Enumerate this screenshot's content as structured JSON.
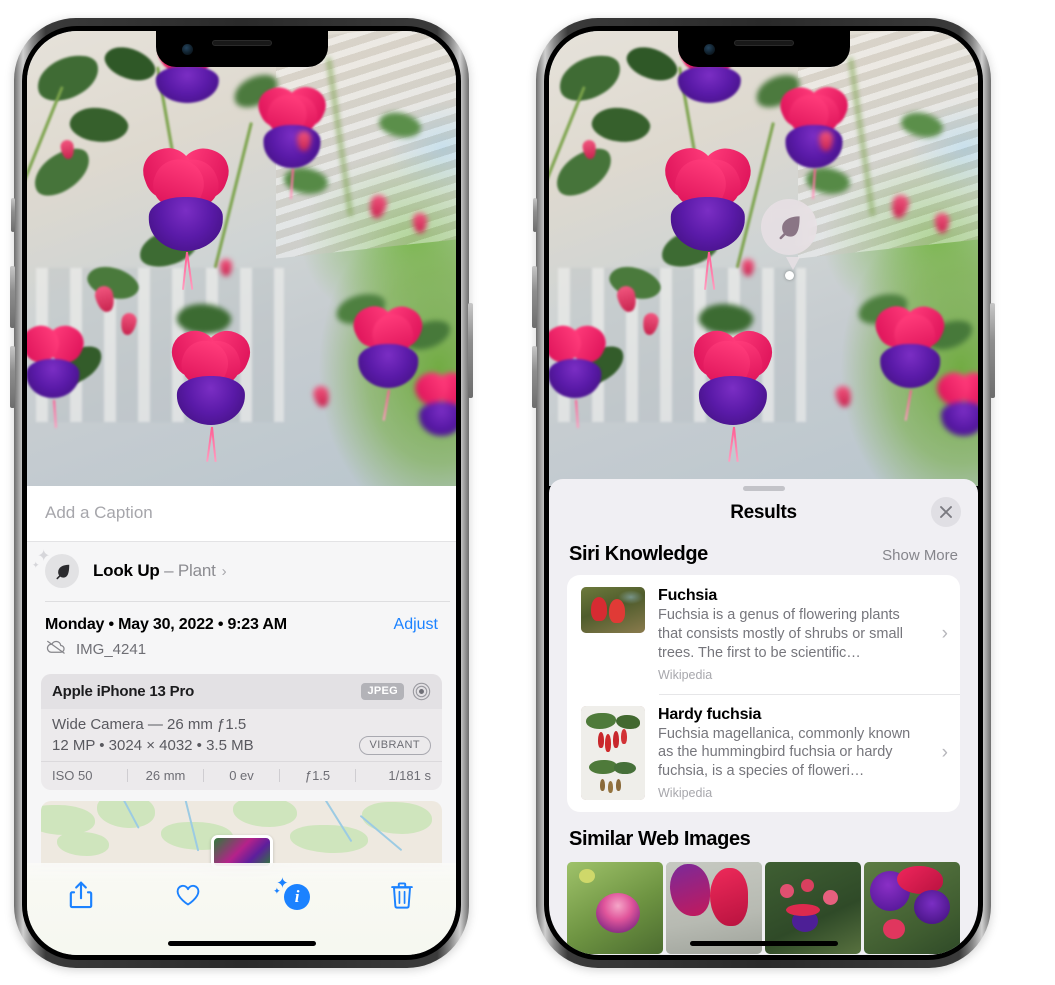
{
  "screenshot": {
    "description": "Two iPhone 13 Pro screenshots side by side showing Photos app Visual Look Up"
  },
  "left_phone": {
    "device_name": "iPhone 13 Pro",
    "photo": {
      "subject": "fuchsia flowers hanging basket",
      "alt": "Pink and purple fuchsia flowers on a porch"
    },
    "caption_field": {
      "placeholder": "Add a Caption",
      "value": ""
    },
    "look_up_row": {
      "icon": "leaf-icon",
      "label": "Look Up",
      "dash": " – ",
      "category": "Plant",
      "chevron": "chevron-right-icon"
    },
    "date_row": {
      "date_text": "Monday • May 30, 2022 • 9:23 AM",
      "adjust_label": "Adjust"
    },
    "file_row": {
      "icon": "cloud-slash-icon",
      "filename": "IMG_4241"
    },
    "camera_card": {
      "model": "Apple iPhone 13 Pro",
      "format_badge": "JPEG",
      "aperture_icon": "aperture-icon",
      "lens_line": "Wide Camera — 26 mm ƒ1.5",
      "size_line": "12 MP • 3024 × 4032 • 3.5 MB",
      "style_badge": "VIBRANT",
      "exif": [
        {
          "label": "ISO 50"
        },
        {
          "label": "26 mm"
        },
        {
          "label": "0 ev"
        },
        {
          "label": "ƒ1.5"
        },
        {
          "label": "1/181 s"
        }
      ]
    },
    "map_card": {
      "name": "location-map-thumbnail"
    },
    "toolbar": {
      "share_label": "share-icon",
      "favorite_label": "heart-icon",
      "info_label": "info-sparkle-icon",
      "delete_label": "trash-icon"
    }
  },
  "right_phone": {
    "device_name": "iPhone 13 Pro",
    "badge": {
      "icon": "leaf-icon",
      "name": "visual-look-up-badge"
    },
    "sheet": {
      "title": "Results",
      "close_icon": "close-icon",
      "sections": [
        {
          "title": "Siri Knowledge",
          "action": "Show More",
          "items": [
            {
              "title": "Fuchsia",
              "description": "Fuchsia is a genus of flowering plants that consists mostly of shrubs or small trees. The first to be scientific…",
              "source": "Wikipedia",
              "thumb": "fuchsia-red-flowers-thumbnail"
            },
            {
              "title": "Hardy fuchsia",
              "description": "Fuchsia magellanica, commonly known as the hummingbird fuchsia or hardy fuchsia, is a species of floweri…",
              "source": "Wikipedia",
              "thumb": "hardy-fuchsia-herbarium-thumbnail"
            }
          ]
        },
        {
          "title": "Similar Web Images",
          "action": "",
          "images": [
            {
              "alt": "pink and purple fuchsia with green leaves"
            },
            {
              "alt": "close-up red fuchsia blossoms"
            },
            {
              "alt": "fuchsia bush with many buds"
            },
            {
              "alt": "purple and red fuchsia flowers"
            }
          ]
        }
      ]
    }
  },
  "colors": {
    "accent_blue": "#1b82ff",
    "panel_bg": "#f6f6f7",
    "sheet_bg": "#f0eff3",
    "card_bg": "#ffffff",
    "secondary_text": "#76767c"
  }
}
